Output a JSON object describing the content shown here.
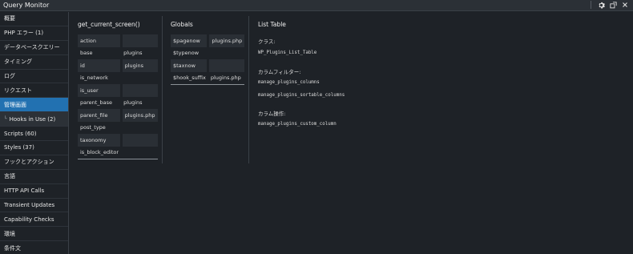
{
  "window": {
    "title": "Query Monitor",
    "icons": [
      "gear-icon",
      "popout-icon",
      "close-icon"
    ]
  },
  "sidebar": {
    "items": [
      {
        "label": "概要"
      },
      {
        "label": "PHP エラー (1)"
      },
      {
        "label": "データベースクエリー"
      },
      {
        "label": "タイミング"
      },
      {
        "label": "ログ"
      },
      {
        "label": "リクエスト"
      },
      {
        "label": "管理画面",
        "active": true
      },
      {
        "label": "Hooks in Use (2)",
        "child": true
      },
      {
        "label": "Scripts (60)"
      },
      {
        "label": "Styles (37)"
      },
      {
        "label": "フックとアクション"
      },
      {
        "label": "言語"
      },
      {
        "label": "HTTP API Calls"
      },
      {
        "label": "Transient Updates"
      },
      {
        "label": "Capability Checks"
      },
      {
        "label": "環境"
      },
      {
        "label": "条件文"
      }
    ]
  },
  "screen_panel": {
    "title": "get_current_screen()",
    "rows": [
      {
        "key": "action",
        "value": ""
      },
      {
        "key": "base",
        "value": "plugins"
      },
      {
        "key": "id",
        "value": "plugins"
      },
      {
        "key": "is_network",
        "value": ""
      },
      {
        "key": "is_user",
        "value": ""
      },
      {
        "key": "parent_base",
        "value": "plugins"
      },
      {
        "key": "parent_file",
        "value": "plugins.php"
      },
      {
        "key": "post_type",
        "value": ""
      },
      {
        "key": "taxonomy",
        "value": ""
      },
      {
        "key": "is_block_editor",
        "value": ""
      }
    ]
  },
  "globals_panel": {
    "title": "Globals",
    "rows": [
      {
        "key": "$pagenow",
        "value": "plugins.php"
      },
      {
        "key": "$typenow",
        "value": ""
      },
      {
        "key": "$taxnow",
        "value": ""
      },
      {
        "key": "$hook_suffix",
        "value": "plugins.php"
      }
    ]
  },
  "list_table_panel": {
    "title": "List Table",
    "class_label": "クラス:",
    "class_value": "WP_Plugins_List_Table",
    "column_filters_label": "カラムフィルター:",
    "column_filters": [
      "manage_plugins_columns",
      "manage_plugins_sortable_columns"
    ],
    "column_action_label": "カラム操作:",
    "column_action": "manage_plugins_custom_column"
  }
}
